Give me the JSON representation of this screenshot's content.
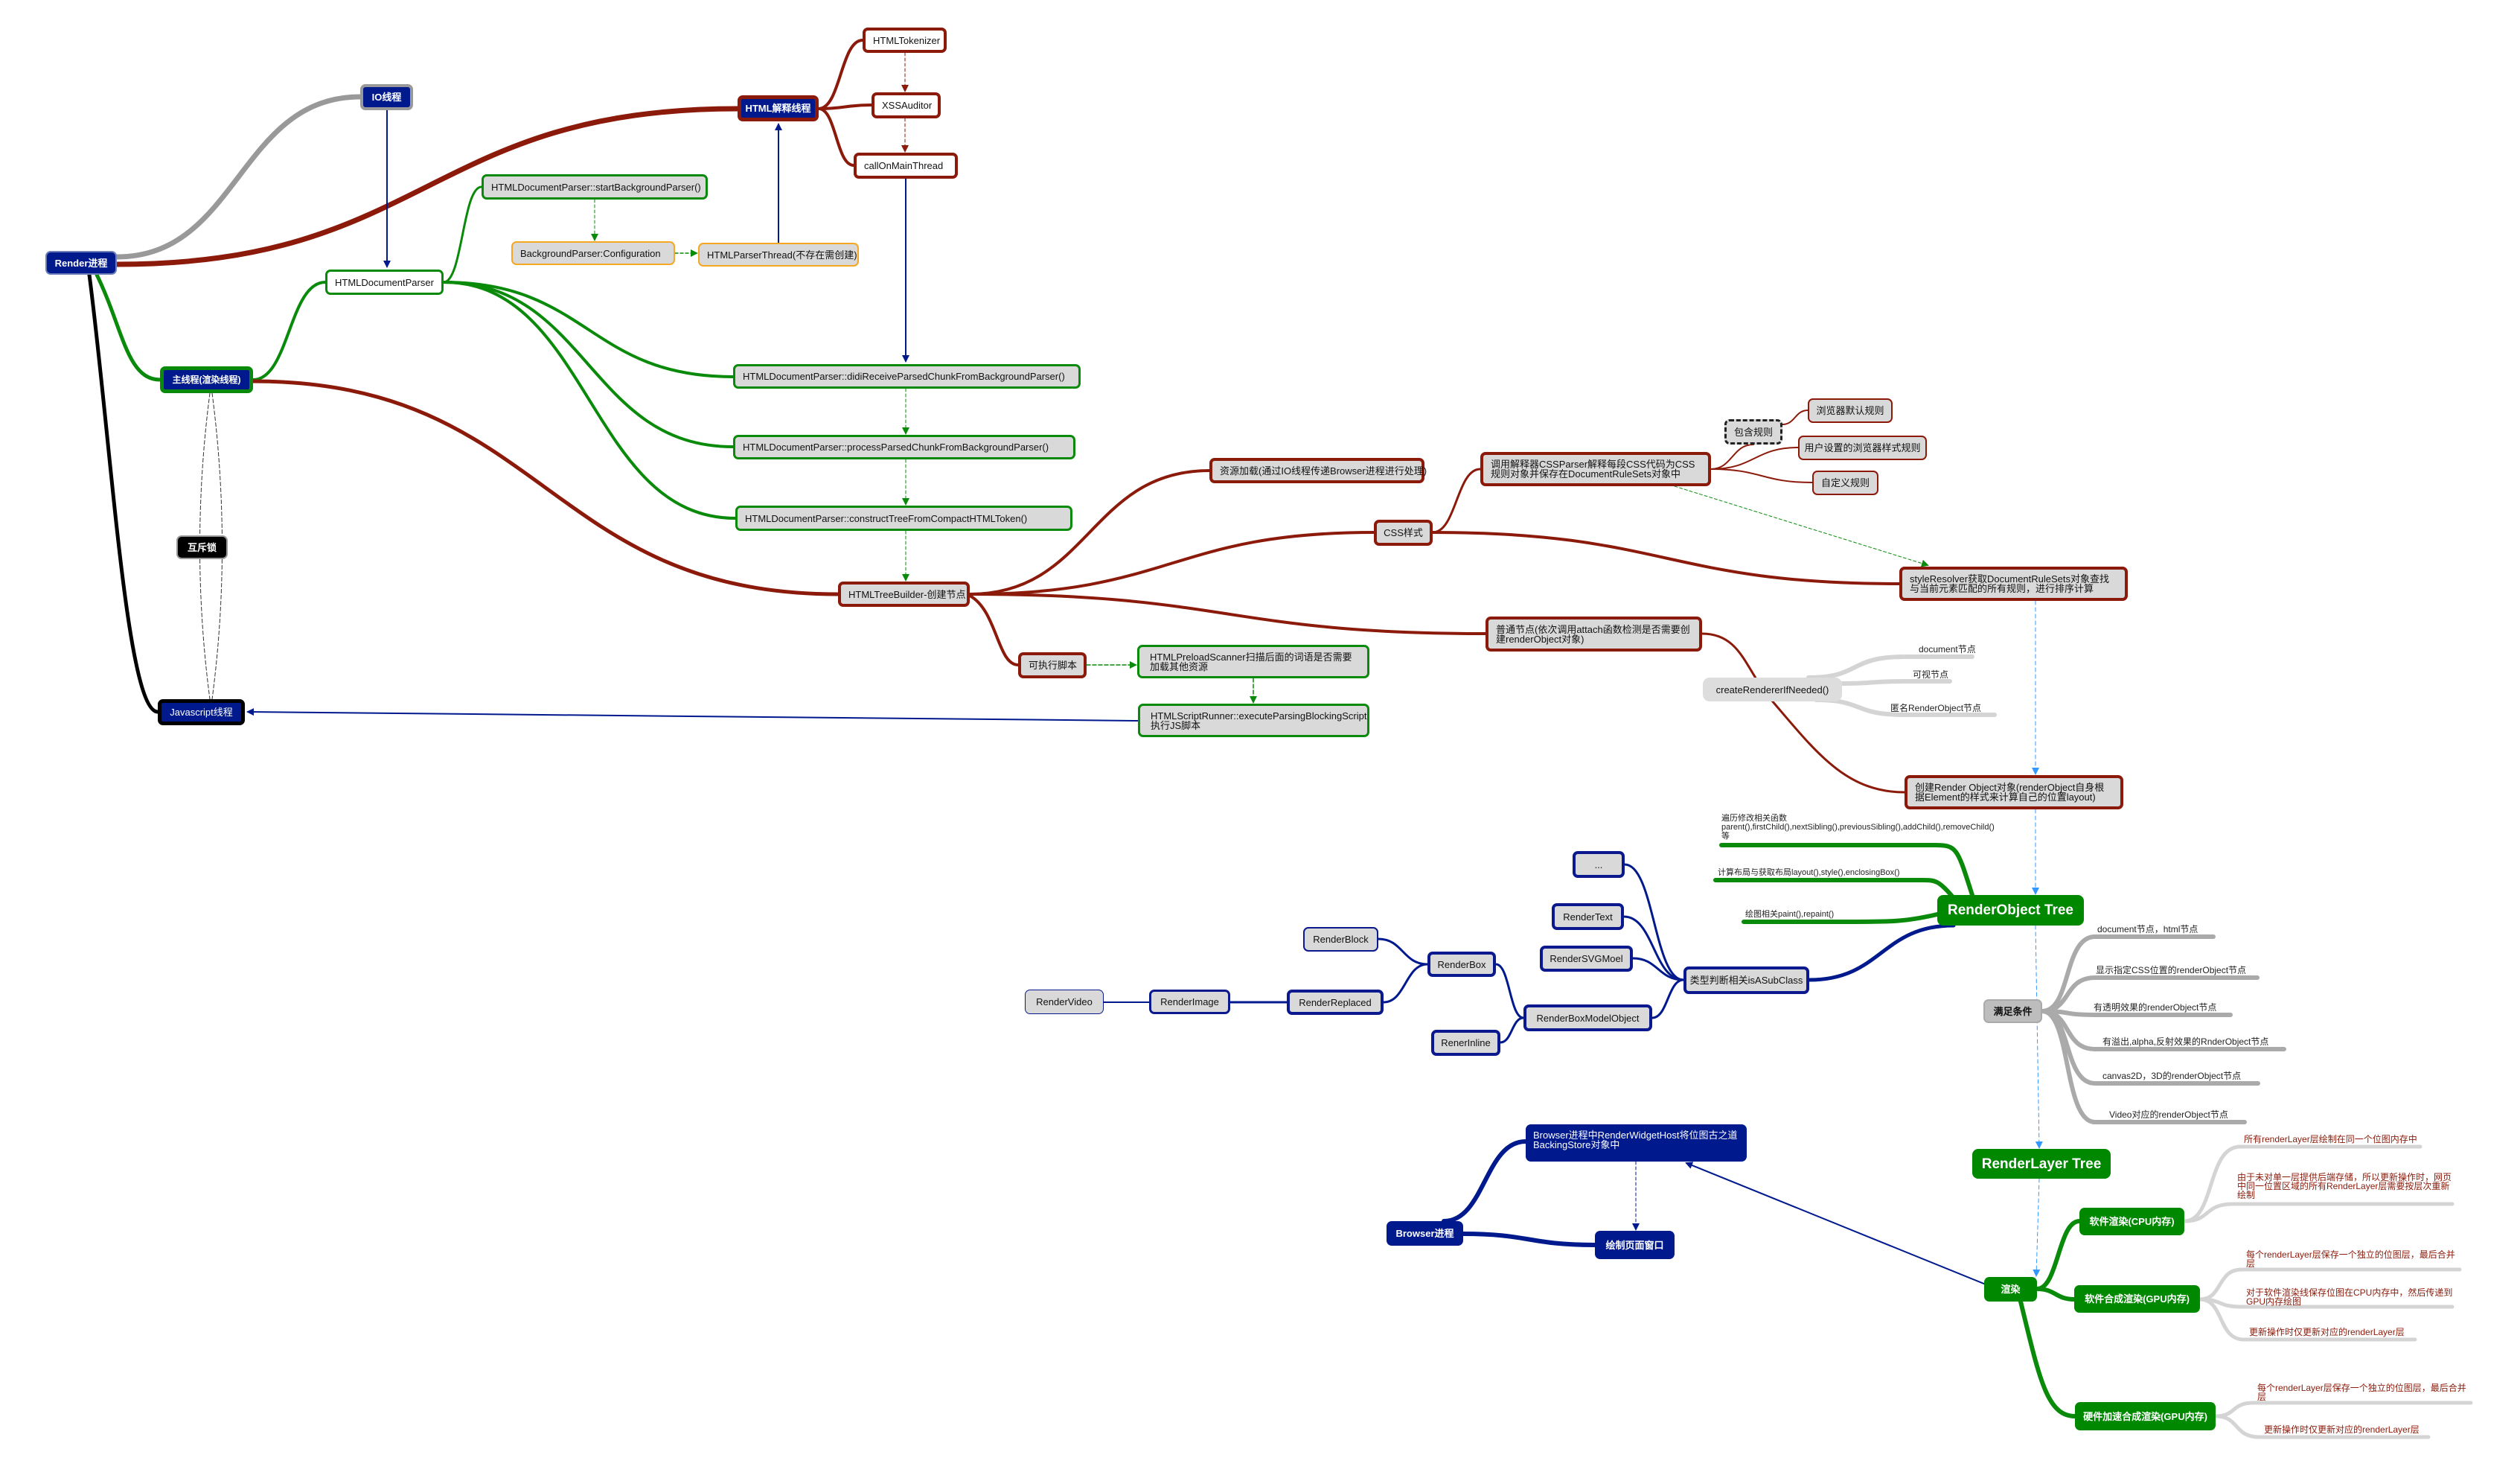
{
  "colors": {
    "dark_red": "#8b1a0a",
    "green": "#0a8a0a",
    "navy": "#001a8e",
    "gray": "#999999",
    "orange": "#f5a623",
    "light_blue": "#3399ff"
  },
  "threads": {
    "render": "Render进程",
    "io": "IO线程",
    "html_parser_thread": "HTML解释线程",
    "main": "主线程(渲染线程)",
    "mutex": "互斥锁",
    "js": "Javascript线程"
  },
  "parser": {
    "tokenizer": "HTMLTokenizer",
    "xss": "XSSAuditor",
    "call_on_main": "callOnMainThread",
    "start_bg": "HTMLDocumentParser::startBackgroundParser()",
    "bg_config": "BackgroundParser:Configuration",
    "parser_thread": "HTMLParserThread(不存在需创建)",
    "doc_parser": "HTMLDocumentParser",
    "did_receive": "HTMLDocumentParser::didiReceiveParsedChunkFromBackgroundParser()",
    "process": "HTMLDocumentParser::processParsedChunkFromBackgroundParser()",
    "construct": "HTMLDocumentParser::constructTreeFromCompactHTMLToken()",
    "tree_builder": "HTMLTreeBuilder-创建节点",
    "exec_script": "可执行脚本",
    "preload": "HTMLPreloadScanner扫描后面的词语是否需要加载其他资源",
    "script_runner": "HTMLScriptRunner::executeParsingBlockingScript执行JS脚本"
  },
  "css": {
    "resource": "资源加载(通过IO线程传递Browser进程进行处理)",
    "css_style": "CSS样式",
    "css_parser": "调用解释器CSSParser解释每段CSS代码为CSS规则对象并保存在DocumentRuleSets对象中",
    "contain_rules": "包含规则",
    "browser_default": "浏览器默认规则",
    "user_rules": "用户设置的浏览器样式规则",
    "custom_rules": "自定义规则",
    "style_resolver": "styleResolver获取DocumentRuleSets对象查找与当前元素匹配的所有规则，进行排序计算"
  },
  "render_object": {
    "normal_node": "普通节点(依次调用attach函数检测是否需要创建renderObject对象)",
    "create_if_needed": "createRendererIfNeeded()",
    "create_labels": [
      "document节点",
      "可视节点",
      "匿名RenderObject节点"
    ],
    "create_ro": "创建Render Object对象(renderObject自身根据Element的样式来计算自己的位置layout)",
    "tree": "RenderObject Tree",
    "functions": [
      "遍历修改相关函数parent(),firstChild(),nextSibling(),previousSibling(),addChild(),removeChild()等",
      "计算布局与获取布局layout(),style(),enclosingBox()",
      "绘图相关paint(),repaint()"
    ],
    "type_check": "类型判断相关isASubClass",
    "classes": {
      "dots": "...",
      "render_text": "RenderText",
      "render_svg": "RenderSVGMoel",
      "box_model": "RenderBoxModelObject",
      "render_box": "RenderBox",
      "render_inline": "RenerInline",
      "render_block": "RenderBlock",
      "render_replaced": "RenderReplaced",
      "render_image": "RenderImage",
      "render_video": "RenderVideo"
    },
    "satisfy": "满足条件",
    "conditions": [
      "document节点，html节点",
      "显示指定CSS位置的renderObject节点",
      "有透明效果的renderObject节点",
      "有溢出,alpha,反射效果的RnderObject节点",
      "canvas2D，3D的renderObject节点",
      "Video对应的renderObject节点"
    ]
  },
  "render_layer": {
    "tree": "RenderLayer Tree",
    "paint": "渲染",
    "cpu": "软件渲染(CPU内存)",
    "soft_gpu": "软件合成渲染(GPU内存)",
    "hw": "硬件加速合成渲染(GPU内存)",
    "cpu_notes": [
      "所有renderLayer层绘制在同一个位图内存中",
      "由于未对单一层提供后端存储，所以更新操作时，网页中同一位置区域的所有RenderLayer层需要按层次重新绘制"
    ],
    "soft_gpu_notes": [
      "每个renderLayer层保存一个独立的位图层，最后合并层",
      "对于软件渲染线保存位图在CPU内存中，然后传递到GPU内存绘图",
      "更新操作时仅更新对应的renderLayer层"
    ],
    "hw_notes": [
      "每个renderLayer层保存一个独立的位图层，最后合并层",
      "更新操作时仅更新对应的renderLayer层"
    ]
  },
  "browser": {
    "process": "Browser进程",
    "rwh": "Browser进程中RenderWidgetHost将位图古之道BackingStore对象中",
    "draw_window": "绘制页面窗口"
  }
}
